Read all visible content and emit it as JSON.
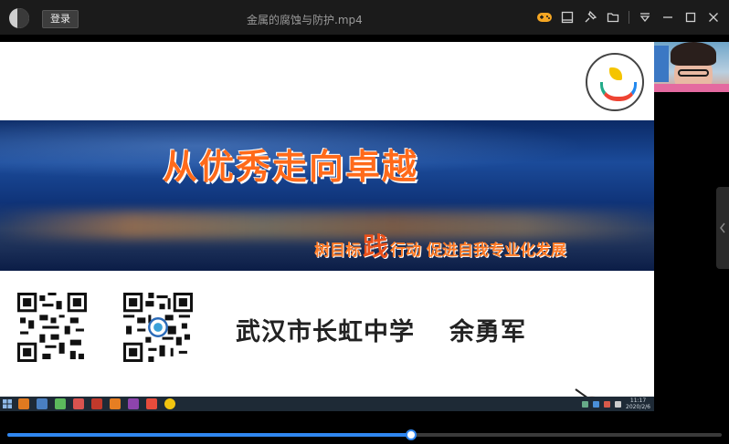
{
  "titlebar": {
    "login_label": "登录",
    "window_title": "金属的腐蚀与防护.mp4",
    "icons": [
      "game-controller-icon",
      "sidebar-panel-icon",
      "pin-icon",
      "folder-icon",
      "dropdown-icon",
      "minimize-icon",
      "maximize-icon",
      "close-icon"
    ]
  },
  "video": {
    "headline": "从优秀走向卓越",
    "subline_prefix": "树目标",
    "subline_big": "践",
    "subline_suffix": "行动  促进自我专业化发展",
    "school_name": "武汉市长虹中学",
    "teacher_name": "余勇军",
    "taskbar_time": "11:17",
    "taskbar_date": "2020/2/6"
  },
  "colors": {
    "headline": "#ff6a1a",
    "progress": "#2f86f0",
    "banner": "#1b4b9a"
  },
  "playback": {
    "progress_fraction": 0.565
  }
}
